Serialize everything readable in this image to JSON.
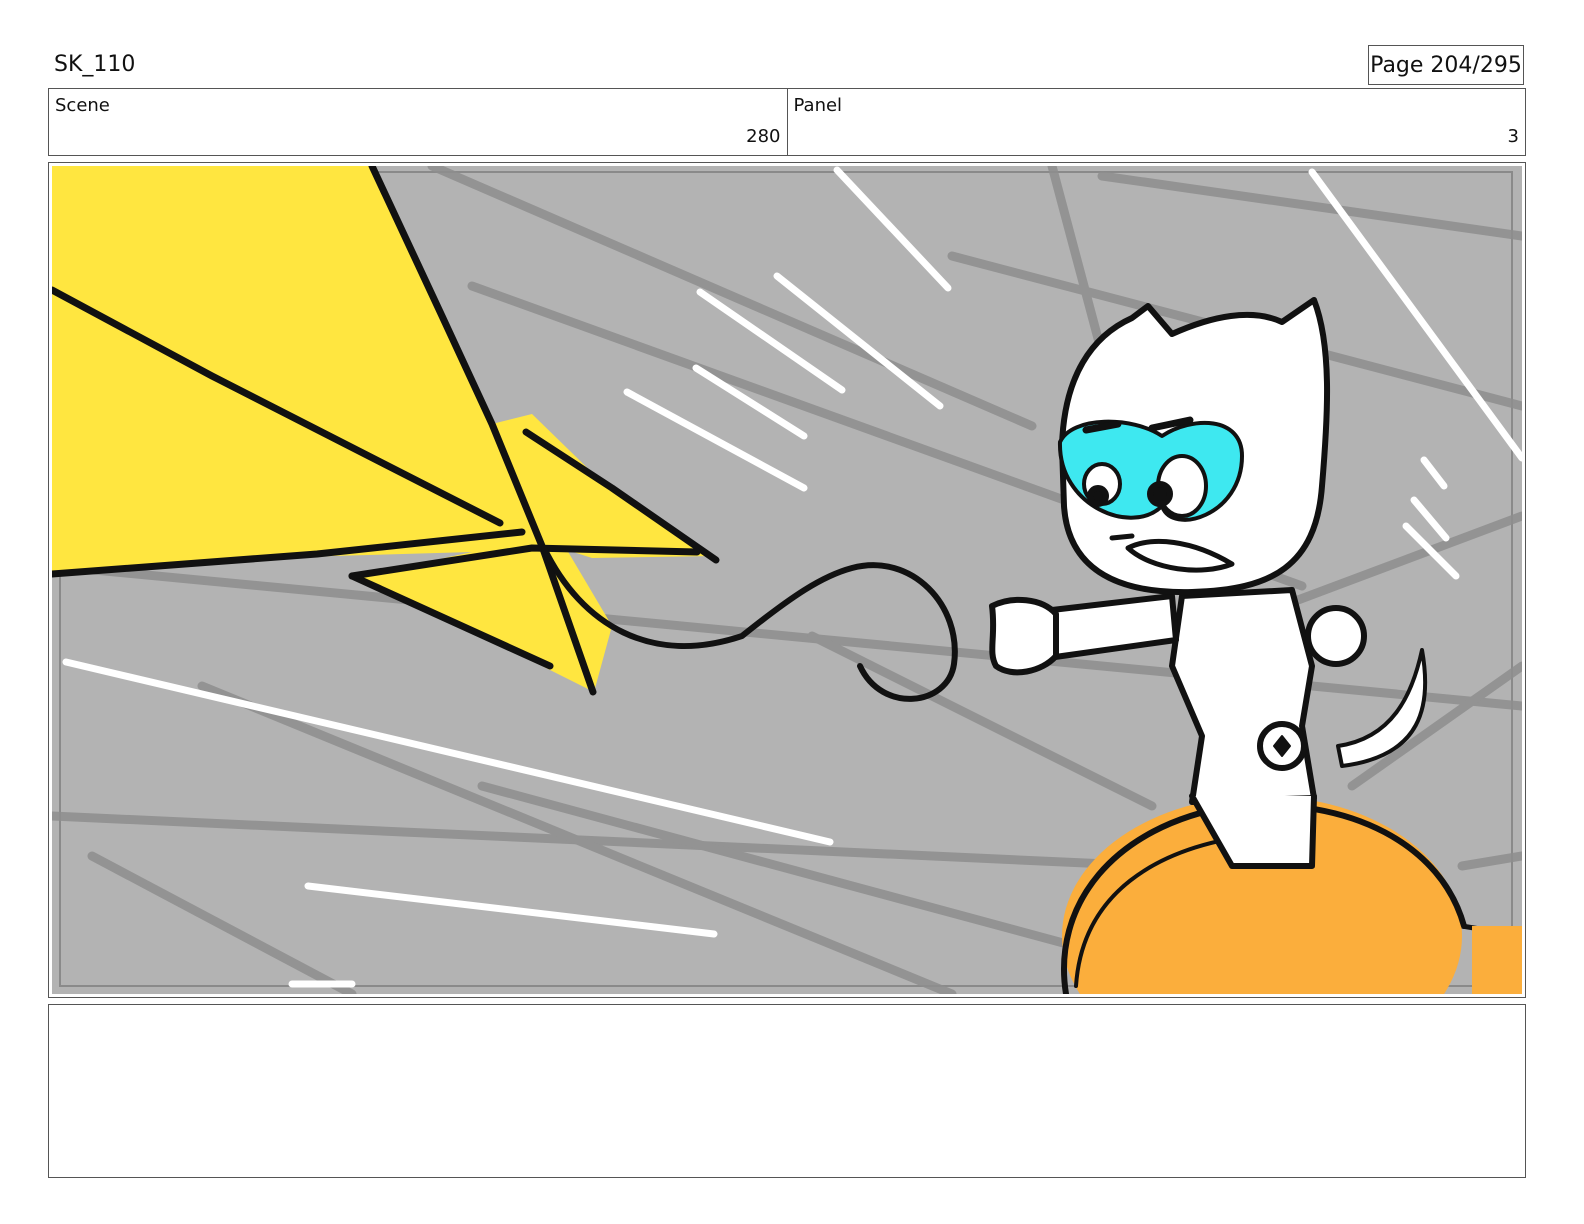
{
  "header": {
    "sequence_code": "SK_110",
    "page_label": "Page 204/295"
  },
  "info": {
    "scene_label": "Scene",
    "scene_value": "280",
    "panel_label": "Panel",
    "panel_value": "3"
  },
  "artwork": {
    "background_color": "#b3b3b3",
    "bolt_color": "#ffe640",
    "mask_color": "#3ee8f0",
    "ball_color": "#fbae3c",
    "character_color": "#ffffff"
  },
  "notes": {
    "text": ""
  }
}
